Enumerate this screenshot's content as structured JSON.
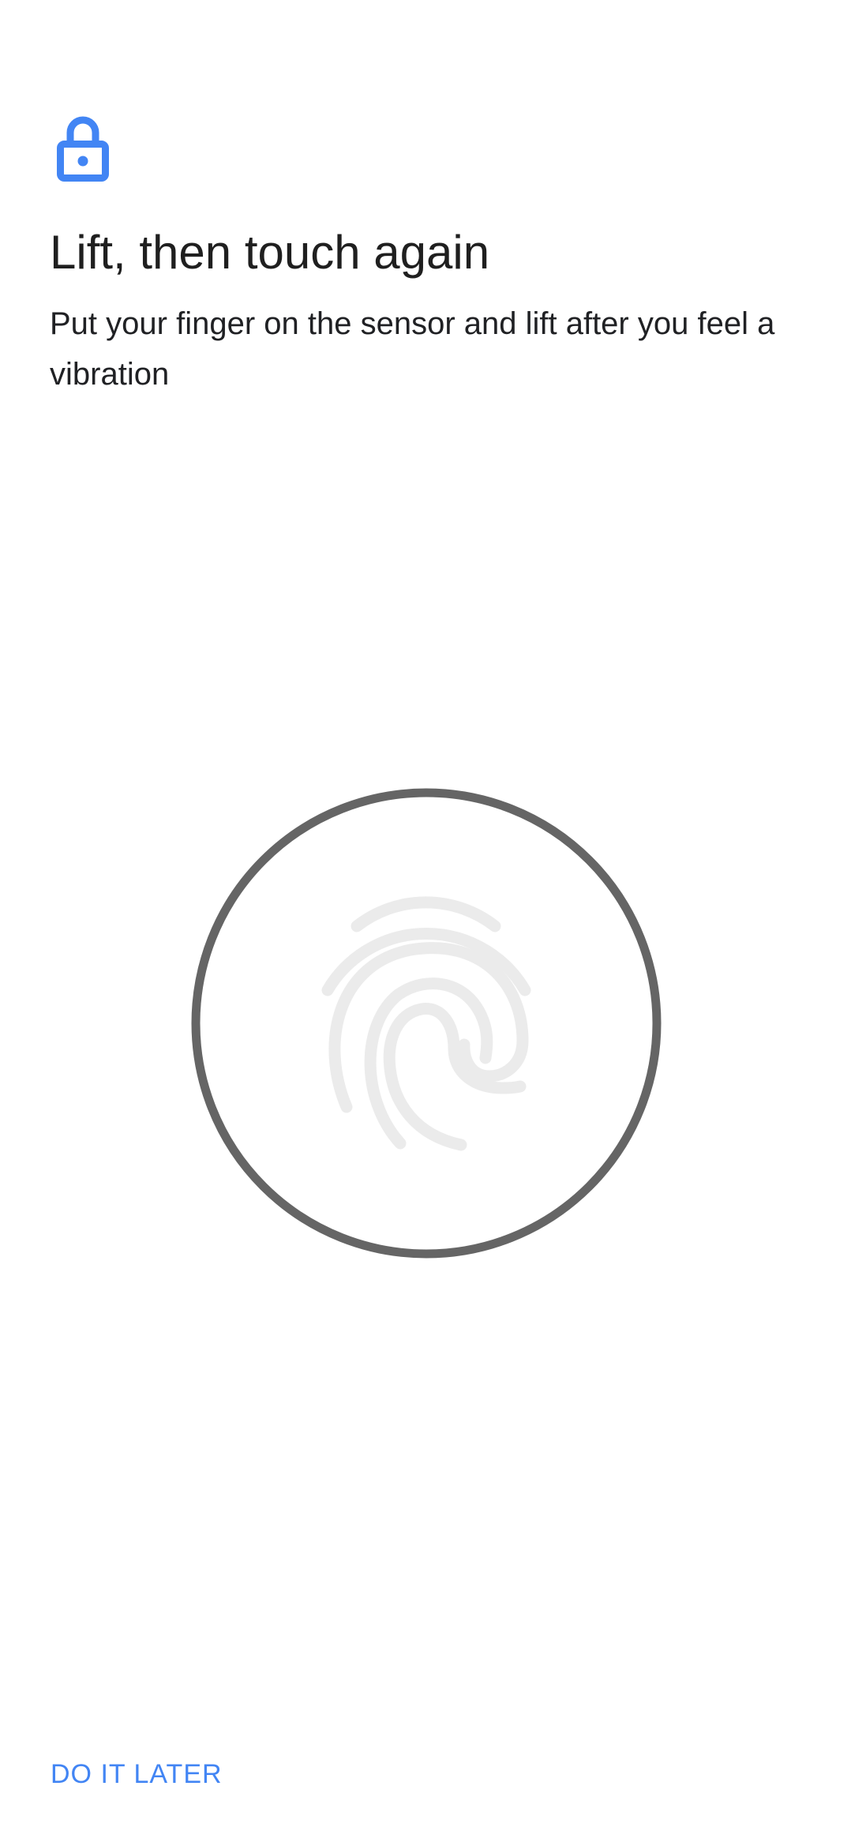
{
  "icons": {
    "lock": "lock-icon",
    "fingerprint": "fingerprint-icon"
  },
  "colors": {
    "accent": "#4285f4",
    "ring": "#656565",
    "fingerprint": "#ebebeb"
  },
  "header": {
    "title": "Lift, then touch again",
    "subtitle": "Put your finger on the sensor and lift after you feel a vibration"
  },
  "footer": {
    "later_label": "DO IT LATER"
  }
}
